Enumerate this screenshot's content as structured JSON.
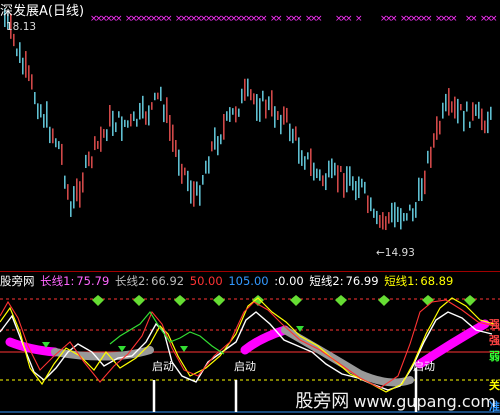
{
  "title": "深发展A(日线)",
  "price": {
    "high_label": "18.13",
    "low_label": "←14.93"
  },
  "indicator": {
    "name": "股旁网",
    "items": [
      {
        "label": "长线1:",
        "value": "75.79",
        "color": "#ff66ff"
      },
      {
        "label": "长线2:",
        "value": "66.92",
        "color": "#bbbbbb"
      },
      {
        "label": "",
        "value": "50.00",
        "color": "#ff3333"
      },
      {
        "label": "",
        "value": "105.00",
        "color": "#3399ff"
      },
      {
        "label": "",
        "value": ":0.00",
        "color": "#ffffff"
      },
      {
        "label": "短线2:",
        "value": "76.99",
        "color": "#ffffff"
      },
      {
        "label": "短线1:",
        "value": "68.89",
        "color": "#ffff00"
      }
    ],
    "launch_label": "启动",
    "right_labels": [
      {
        "text": "强",
        "color": "#ff4444"
      },
      {
        "text": "强",
        "color": "#ff4444"
      },
      {
        "text": "弱",
        "color": "#33ff33"
      },
      {
        "text": "关",
        "color": "#ffff00"
      },
      {
        "text": "准",
        "color": "#3399ff"
      }
    ]
  },
  "watermark": {
    "brand": "股旁网",
    "url": "www.gupang.com"
  },
  "colors": {
    "up": "#d04848",
    "down": "#5fbfd0",
    "marker": "#ff33ff",
    "diamond": "#66dd33"
  }
}
